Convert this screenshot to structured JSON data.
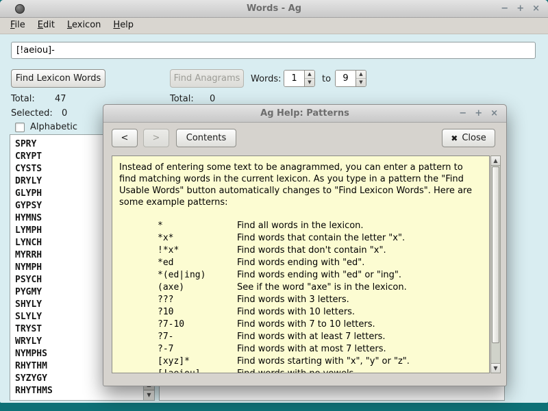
{
  "icons": {
    "arrow_up": "▲",
    "arrow_down": "▼",
    "minimize": "−",
    "maximize": "+",
    "close": "×"
  },
  "window": {
    "title": "Words - Ag",
    "menus": [
      {
        "label": "File"
      },
      {
        "label": "Edit"
      },
      {
        "label": "Lexicon"
      },
      {
        "label": "Help"
      }
    ]
  },
  "pattern_entry": {
    "value": "[!aeiou]-"
  },
  "controls": {
    "find_lexicon_label": "Find Lexicon Words",
    "find_anagrams_label": "Find Anagrams",
    "words_label": "Words:",
    "words_from": "1",
    "to_label": "to",
    "words_to": "9"
  },
  "left_panel": {
    "total_label": "Total:",
    "total_value": "47",
    "selected_label": "Selected:",
    "selected_value": "0",
    "alphabetic_label": "Alphabetic",
    "words": [
      "SPRY",
      "CRYPT",
      "CYSTS",
      "DRYLY",
      "GLYPH",
      "GYPSY",
      "HYMNS",
      "LYMPH",
      "LYNCH",
      "MYRRH",
      "NYMPH",
      "PSYCH",
      "PYGMY",
      "SHYLY",
      "SLYLY",
      "TRYST",
      "WRYLY",
      "NYMPHS",
      "RHYTHM",
      "SYZYGY",
      "RHYTHMS"
    ]
  },
  "right_panel": {
    "total_label": "Total:",
    "total_value": "0"
  },
  "help_dialog": {
    "title": "Ag Help: Patterns",
    "back_label": "<",
    "forward_label": ">",
    "contents_label": "Contents",
    "close_icon": "✖",
    "close_label": "Close",
    "intro": "Instead of entering some text to be anagrammed, you can enter a pattern to find matching words in the current lexicon. As you type in a pattern the \"Find Usable Words\" button automatically changes to \"Find Lexicon Words\". Here are some example patterns:",
    "patterns": [
      {
        "pattern": "*",
        "description": "Find all words in the lexicon."
      },
      {
        "pattern": "*x*",
        "description": "Find words that contain the letter \"x\"."
      },
      {
        "pattern": "!*x*",
        "description": "Find words that don't contain \"x\"."
      },
      {
        "pattern": "*ed",
        "description": "Find words ending with \"ed\"."
      },
      {
        "pattern": "*(ed|ing)",
        "description": "Find words ending with \"ed\" or \"ing\"."
      },
      {
        "pattern": "(axe)",
        "description": "See if the word \"axe\" is in the lexicon."
      },
      {
        "pattern": "???",
        "description": "Find words with 3 letters."
      },
      {
        "pattern": "?10",
        "description": "Find words with 10 letters."
      },
      {
        "pattern": "?7-10",
        "description": "Find words with 7 to 10 letters."
      },
      {
        "pattern": "?7-",
        "description": "Find words with at least 7 letters."
      },
      {
        "pattern": "?-7",
        "description": "Find words with at most 7 letters."
      },
      {
        "pattern": "[xyz]*",
        "description": "Find words starting with \"x\", \"y\" or \"z\"."
      },
      {
        "pattern": "[!aeiou]-",
        "description": "Find words with no vowels."
      }
    ]
  },
  "colors": {
    "desktop": "#0e7076",
    "content_bg": "#d9edf1",
    "help_bg": "#fcfcd2"
  }
}
